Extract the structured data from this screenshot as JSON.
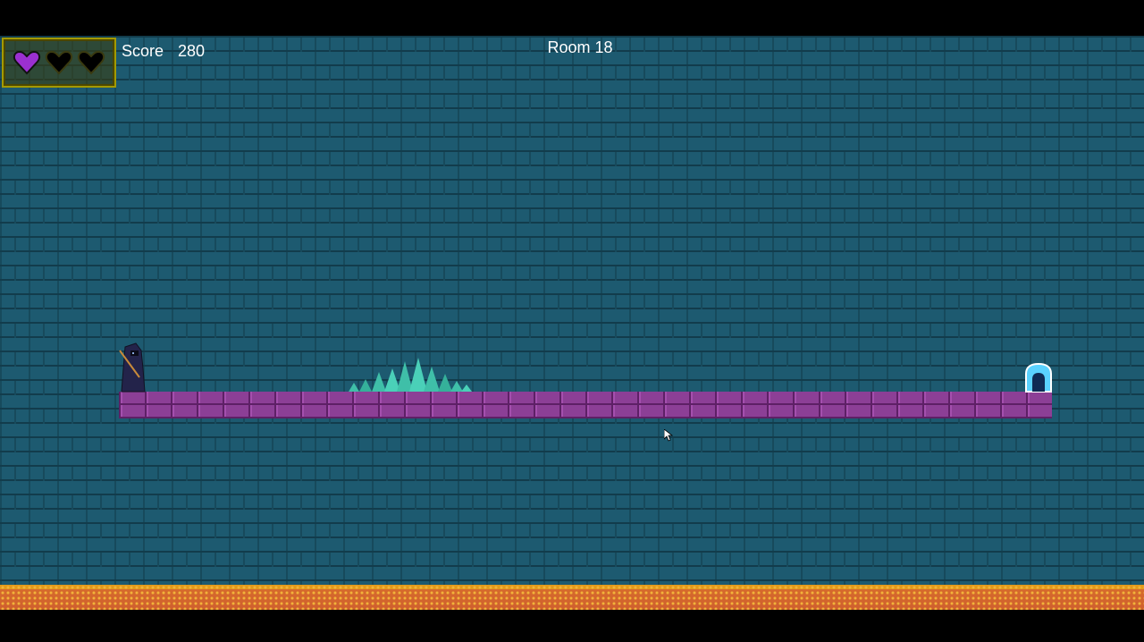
{
  "hud": {
    "hearts": [
      {
        "state": "full",
        "color": "#9b30d0"
      },
      {
        "state": "empty",
        "color": "#000000"
      },
      {
        "state": "empty",
        "color": "#000000"
      }
    ],
    "score_label": "Score",
    "score_value": "280",
    "room_label": "Room 18"
  },
  "colors": {
    "wall": "#1d5a70",
    "wall_mortar": "#123c4c",
    "platform": "#8c3f96",
    "spikes": "#3fbfa8",
    "door": "#5ad2ff",
    "lava": "#d8672b",
    "hud_border": "#a39a00"
  },
  "icons": {
    "heart": "heart-icon",
    "player": "hooded-player-sprite",
    "exit": "exit-door-icon",
    "cursor": "mouse-cursor-icon"
  }
}
